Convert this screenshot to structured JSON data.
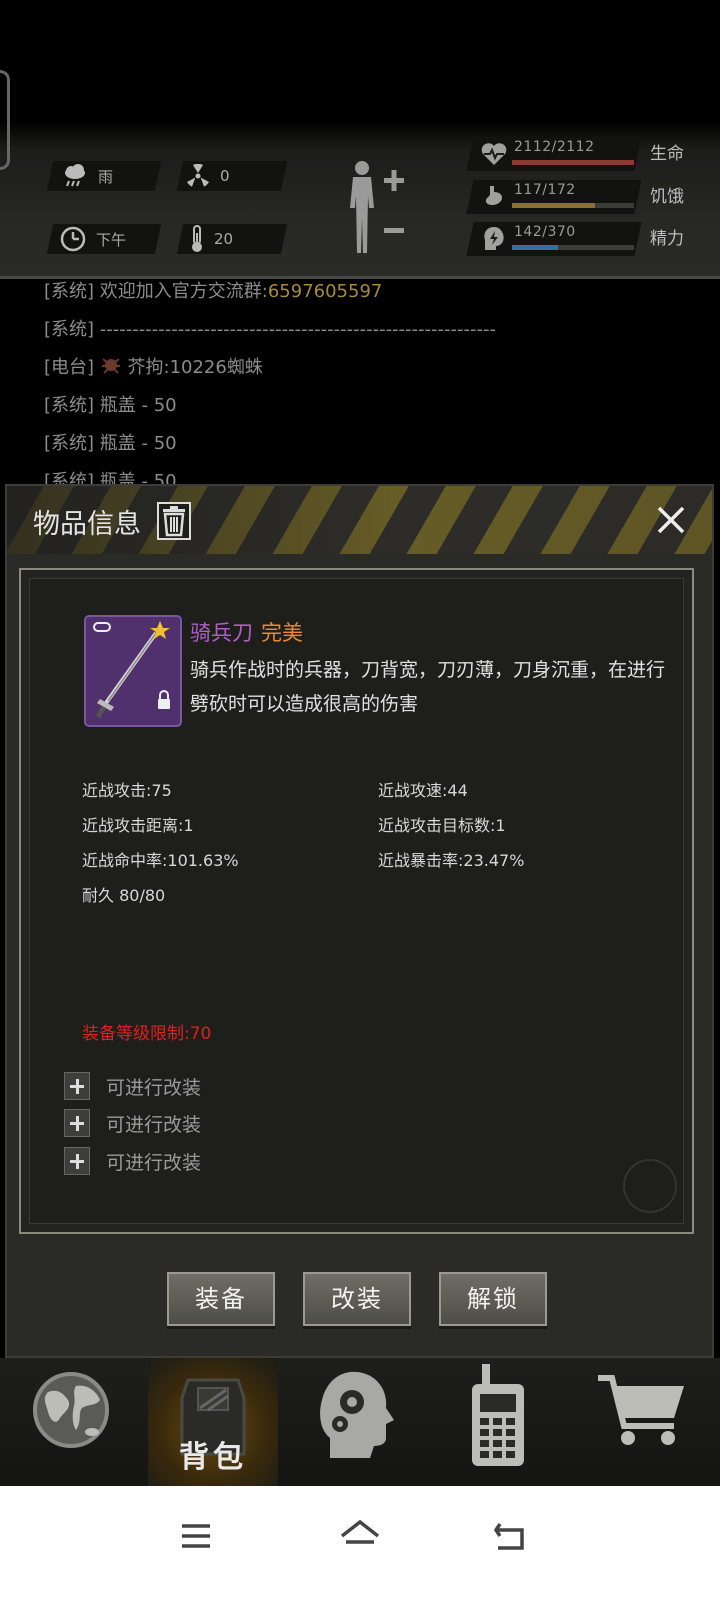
{
  "hud": {
    "weather": "雨",
    "radiation": "0",
    "time_of_day": "下午",
    "temperature": "20",
    "stats": [
      {
        "value": "2112/2112",
        "label": "生命",
        "icon": "heart-icon",
        "ratio": 1.0,
        "color": "#8a3a30"
      },
      {
        "value": "117/172",
        "label": "饥饿",
        "icon": "stomach-icon",
        "ratio": 0.68,
        "color": "#8a7030"
      },
      {
        "value": "142/370",
        "label": "精力",
        "icon": "energy-icon",
        "ratio": 0.38,
        "color": "#3a6aa8"
      }
    ]
  },
  "chat": {
    "lines": [
      {
        "prefix": "[系统]",
        "text": "欢迎加入官方交流群",
        "extra": ":6597605597"
      },
      {
        "prefix": "[系统]",
        "text": "-------------------------------------------------------------",
        "extra": ""
      },
      {
        "prefix": "[电台]",
        "text": "芥拘:10226蜘蛛",
        "extra": ""
      },
      {
        "prefix": "[系统]",
        "text": "瓶盖 - 50",
        "extra": ""
      },
      {
        "prefix": "[系统]",
        "text": "瓶盖 - 50",
        "extra": ""
      },
      {
        "prefix": "[系统]",
        "text": "瓶盖 - 50",
        "extra": ""
      }
    ]
  },
  "modal": {
    "title": "物品信息",
    "item": {
      "name": "骑兵刀",
      "quality": "完美",
      "description": "骑兵作战时的兵器，刀背宽，刀刃薄，刀身沉重，在进行劈砍时可以造成很高的伤害"
    },
    "attributes": {
      "left": [
        "近战攻击:75",
        "近战攻击距离:1",
        "近战命中率:101.63%",
        "耐久 80/80"
      ],
      "right": [
        "近战攻速:44",
        "近战攻击目标数:1",
        "近战暴击率:23.47%"
      ]
    },
    "requirement": "装备等级限制:70",
    "mod_slots": [
      "可进行改装",
      "可进行改装",
      "可进行改装"
    ],
    "buttons": {
      "equip": "装备",
      "modify": "改装",
      "unlock": "解锁"
    }
  },
  "nav": {
    "backpack_label": "背包"
  }
}
